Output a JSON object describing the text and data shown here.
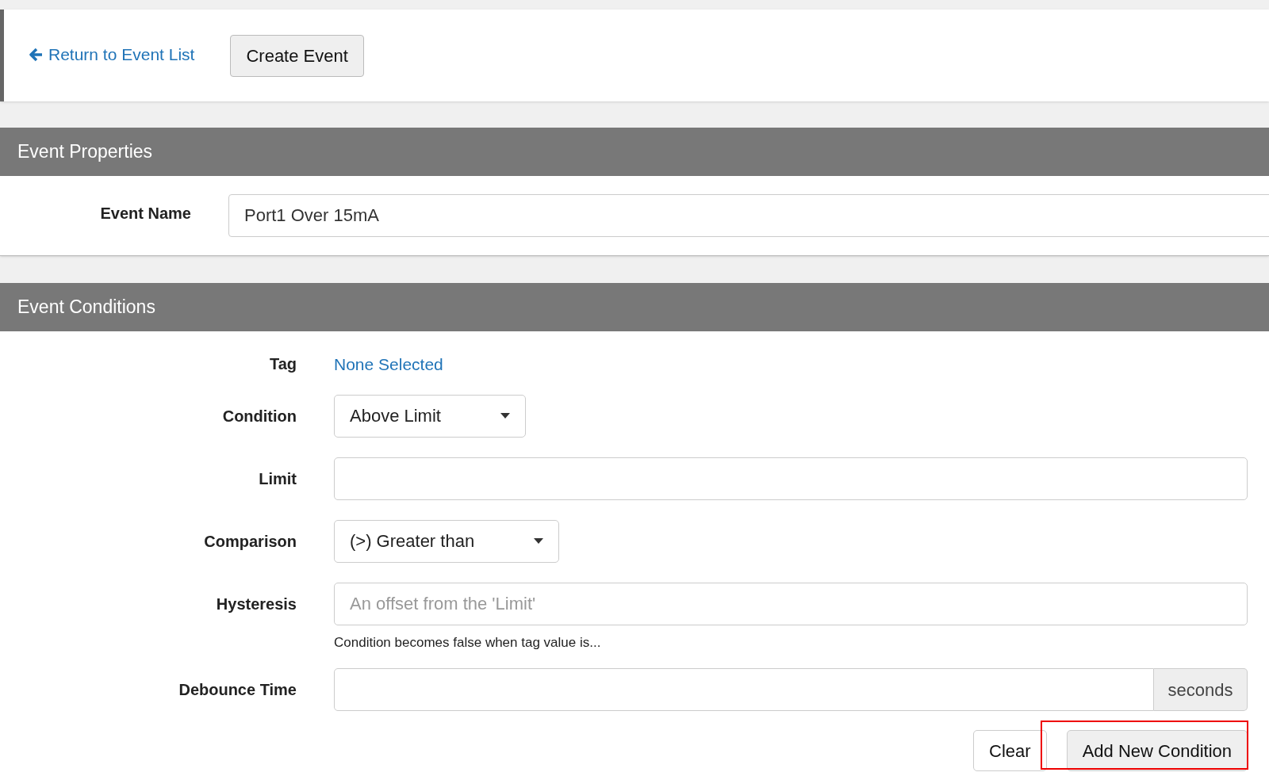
{
  "toolbar": {
    "back_link": "Return to Event List",
    "create_button": "Create Event"
  },
  "properties": {
    "title": "Event Properties",
    "fields": [
      {
        "label": "Event Name",
        "value": "Port1 Over 15mA"
      }
    ]
  },
  "conditions": {
    "title": "Event Conditions",
    "rows": [
      {
        "kind": "link",
        "label": "Tag",
        "value": "None Selected"
      },
      {
        "kind": "select",
        "label": "Condition",
        "value": "Above Limit"
      },
      {
        "kind": "input",
        "label": "Limit"
      },
      {
        "kind": "select",
        "label": "Comparison",
        "value": "(>) Greater than"
      },
      {
        "kind": "input",
        "label": "Hysteresis",
        "placeholder": "An offset from the 'Limit'",
        "help": "Condition becomes false when tag value is..."
      },
      {
        "kind": "addon",
        "label": "Debounce Time",
        "addon": "seconds"
      }
    ],
    "buttons": [
      {
        "label": "Clear",
        "kind": "plain",
        "highlighted": false
      },
      {
        "label": "Add New Condition",
        "kind": "gray",
        "highlighted": true
      }
    ]
  }
}
